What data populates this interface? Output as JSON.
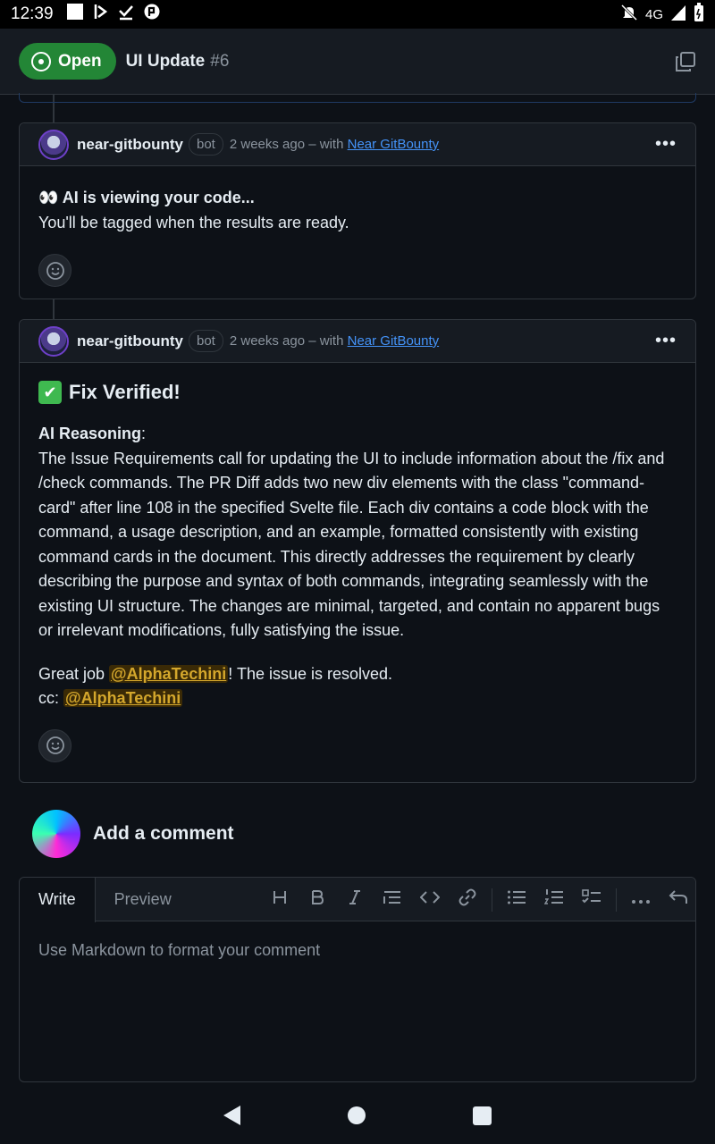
{
  "status_bar": {
    "time": "12:39",
    "network": "4G",
    "icons": [
      "square-icon",
      "media-icon",
      "download-done-icon",
      "app-icon",
      "mute-icon",
      "signal-icon",
      "battery-icon"
    ]
  },
  "header": {
    "state_label": "Open",
    "title": "UI Update",
    "number": "#6"
  },
  "comments": [
    {
      "author": "near-gitbounty",
      "badge": "bot",
      "meta": "2 weeks ago – with",
      "app_link": "Near GitBounty",
      "line1": "👀 AI is viewing your code...",
      "line2": "You'll be tagged when the results are ready."
    },
    {
      "author": "near-gitbounty",
      "badge": "bot",
      "meta": "2 weeks ago – with",
      "app_link": "Near GitBounty",
      "heading": "Fix Verified!",
      "reasoning_label": "AI Reasoning",
      "reasoning_colon": ":",
      "reasoning_text": "The Issue Requirements call for updating the UI to include information about the /fix and /check commands. The PR Diff adds two new div elements with the class \"command-card\" after line 108 in the specified Svelte file. Each div contains a code block with the command, a usage description, and an example, formatted consistently with existing command cards in the document. This directly addresses the requirement by clearly describing the purpose and syntax of both commands, integrating seamlessly with the existing UI structure. The changes are minimal, targeted, and contain no apparent bugs or irrelevant modifications, fully satisfying the issue.",
      "great_prefix": "Great job ",
      "mention": "@AlphaTechini",
      "great_suffix": "! The issue is resolved.",
      "cc_prefix": "cc: ",
      "cc_mention": "@AlphaTechini"
    }
  ],
  "composer": {
    "title": "Add a comment",
    "tab_write": "Write",
    "tab_preview": "Preview",
    "placeholder": "Use Markdown to format your comment"
  },
  "colors": {
    "background": "#0d1117",
    "open_green": "#238636",
    "link": "#4493f8",
    "mention": "#d4a72c"
  }
}
